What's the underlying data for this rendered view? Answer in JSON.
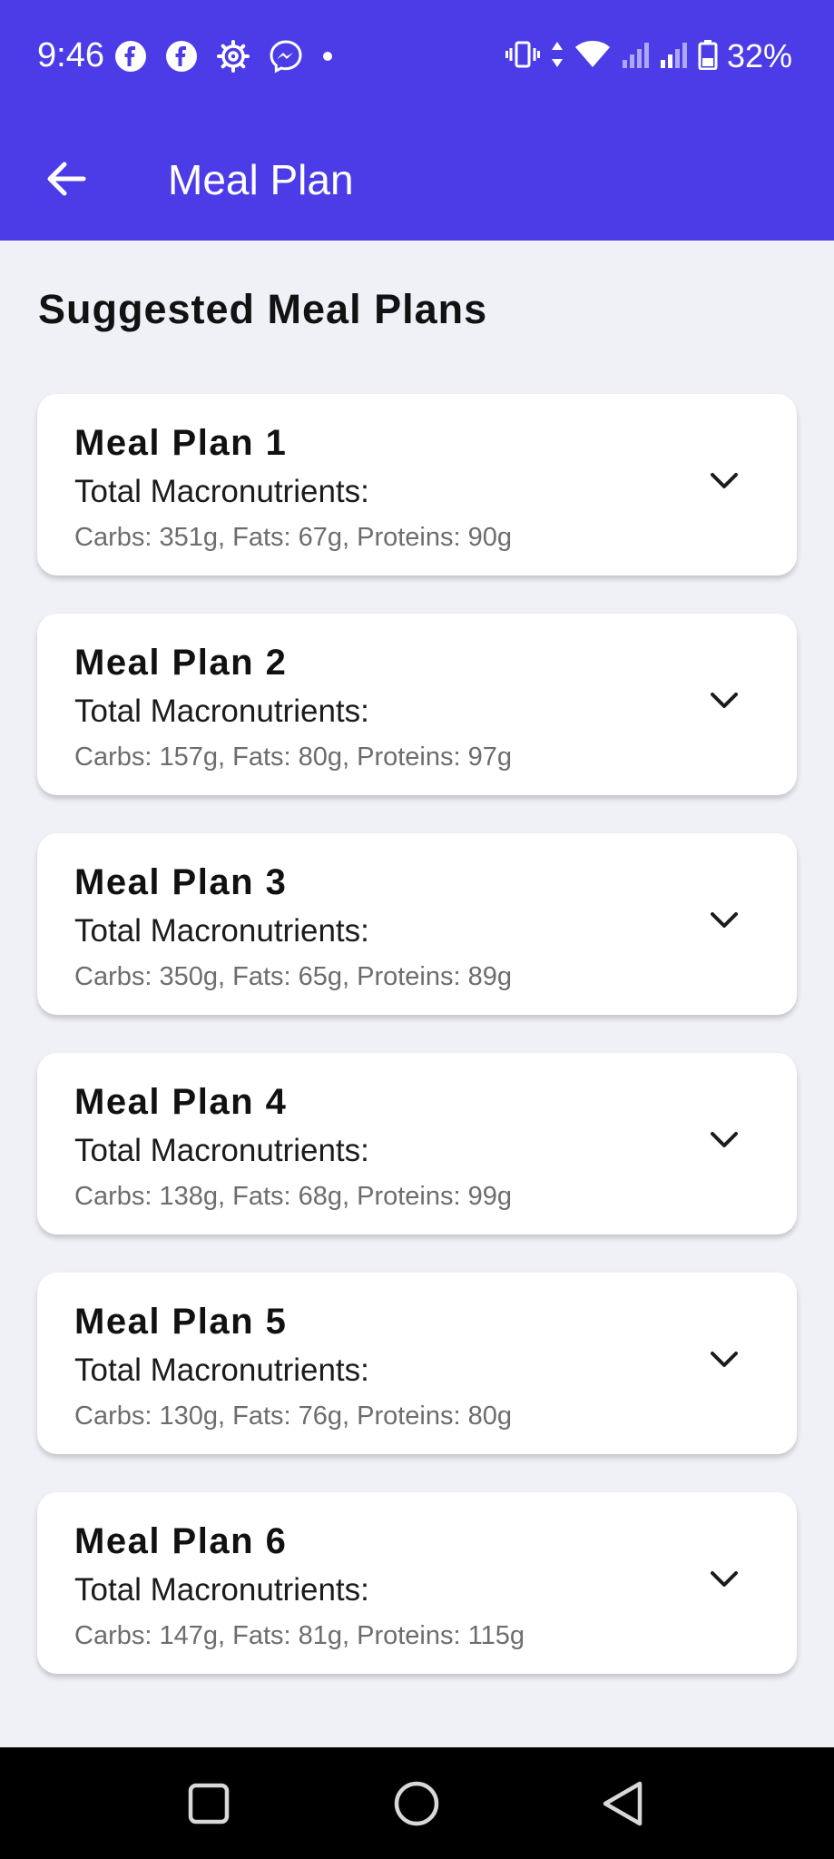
{
  "status_bar": {
    "time": "9:46",
    "battery_percent": "32%",
    "left_icons": [
      "facebook-icon",
      "facebook-icon",
      "settings-gear-icon",
      "messenger-icon",
      "dot-icon"
    ],
    "right_icons": [
      "vibrate-icon",
      "data-arrows-icon",
      "wifi-icon",
      "signal-icon",
      "signal-icon",
      "battery-icon"
    ]
  },
  "app_bar": {
    "title": "Meal Plan",
    "back_icon": "arrow-left-icon",
    "background": "#4b3ce8"
  },
  "main": {
    "section_title": "Suggested Meal Plans",
    "plans": [
      {
        "title": "Meal Plan 1",
        "subtitle": "Total Macronutrients:",
        "macros": "Carbs: 351g, Fats: 67g, Proteins: 90g"
      },
      {
        "title": "Meal Plan 2",
        "subtitle": "Total Macronutrients:",
        "macros": "Carbs: 157g, Fats: 80g, Proteins: 97g"
      },
      {
        "title": "Meal Plan 3",
        "subtitle": "Total Macronutrients:",
        "macros": "Carbs: 350g, Fats: 65g, Proteins: 89g"
      },
      {
        "title": "Meal Plan 4",
        "subtitle": "Total Macronutrients:",
        "macros": "Carbs: 138g, Fats: 68g, Proteins: 99g"
      },
      {
        "title": "Meal Plan 5",
        "subtitle": "Total Macronutrients:",
        "macros": "Carbs: 130g, Fats: 76g, Proteins: 80g"
      },
      {
        "title": "Meal Plan 6",
        "subtitle": "Total Macronutrients:",
        "macros": "Carbs: 147g, Fats: 81g, Proteins: 115g"
      }
    ]
  },
  "nav_bar": {
    "buttons": [
      "recents-square-icon",
      "home-circle-icon",
      "back-triangle-icon"
    ]
  }
}
